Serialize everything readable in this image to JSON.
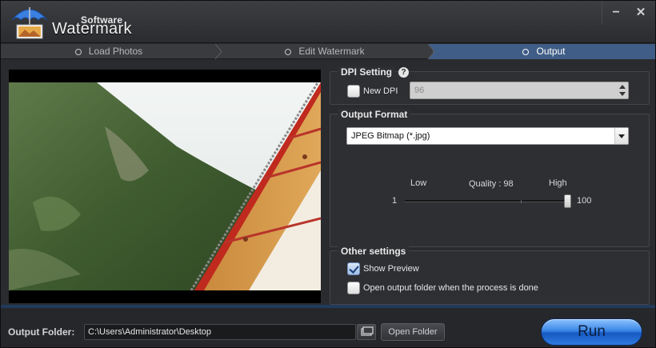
{
  "app": {
    "brand_top": "Software",
    "brand_main": "Watermark",
    "minimize_symbol": "−",
    "close_symbol": "✕",
    "accent_color": "#3f5d86",
    "icons": [
      "umbrella-logo-icon",
      "help-icon",
      "folder-browse-icon",
      "chevron-right-icon",
      "spin-arrows-icon",
      "dropdown-arrow-icon",
      "checkmark-icon"
    ]
  },
  "steps": [
    {
      "label": "Load Photos",
      "active": false
    },
    {
      "label": "Edit Watermark",
      "active": false
    },
    {
      "label": "Output",
      "active": true
    }
  ],
  "dpi": {
    "title": "DPI Setting",
    "help": "?",
    "checkbox_label": "New DPI",
    "checked": false,
    "value": "96"
  },
  "format": {
    "title": "Output Format",
    "selected": "JPEG Bitmap (*.jpg)",
    "quality_low": "Low",
    "quality_label": "Quality : 98",
    "quality_high": "High",
    "min": "1",
    "max": "100",
    "quality_value": 98
  },
  "other": {
    "title": "Other settings",
    "show_preview_label": "Show Preview",
    "show_preview_checked": true,
    "open_folder_label": "Open output folder when the process is done",
    "open_folder_checked": false
  },
  "output": {
    "label": "Output Folder:",
    "path": "C:\\Users\\Administrator\\Desktop",
    "open_button": "Open Folder",
    "run_button": "Run"
  }
}
